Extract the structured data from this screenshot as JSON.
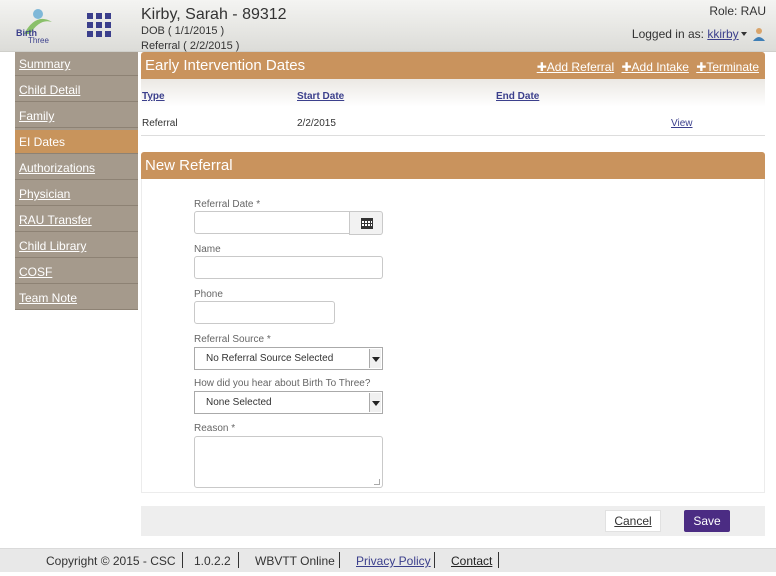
{
  "header": {
    "logo_text": "Birth to Three",
    "child_name": "Kirby, Sarah - 89312",
    "dob": "DOB ( 1/1/2015 )",
    "referral": "Referral ( 2/2/2015 )",
    "role": "Role: RAU",
    "logged_in_label": "Logged in as:",
    "username": "kkirby"
  },
  "sidebar": {
    "items": [
      {
        "label": "Summary"
      },
      {
        "label": "Child Detail"
      },
      {
        "label": "Family"
      },
      {
        "label": "EI Dates"
      },
      {
        "label": "Authorizations"
      },
      {
        "label": "Physician"
      },
      {
        "label": "RAU Transfer"
      },
      {
        "label": "Child Library"
      },
      {
        "label": "COSF"
      },
      {
        "label": "Team Note"
      }
    ],
    "active_index": 3
  },
  "ei_dates": {
    "title": "Early Intervention Dates",
    "actions": [
      "Add Referral",
      "Add Intake",
      "Terminate"
    ],
    "columns": [
      "Type",
      "Start Date",
      "End Date"
    ],
    "rows": [
      {
        "type": "Referral",
        "start": "2/2/2015",
        "end": "",
        "action": "View"
      }
    ]
  },
  "new_referral": {
    "title": "New Referral",
    "fields": {
      "referral_date": {
        "label": "Referral Date",
        "value": ""
      },
      "name": {
        "label": "Name",
        "value": ""
      },
      "phone": {
        "label": "Phone",
        "value": ""
      },
      "referral_source": {
        "label": "Referral Source",
        "value": "No Referral Source Selected"
      },
      "heard_about": {
        "label": "How did you hear about Birth To Three?",
        "value": "None Selected"
      },
      "reason": {
        "label": "Reason",
        "value": ""
      }
    },
    "required_marker": "*",
    "cancel_label": "Cancel",
    "save_label": "Save"
  },
  "footer": {
    "copyright": "Copyright © 2015 - CSC",
    "version": "1.0.2.2",
    "app_name": "WBVTT Online",
    "privacy": "Privacy Policy",
    "contact": "Contact"
  },
  "colors": {
    "accent": "#c9935d",
    "sidebar": "#a59a8c",
    "primary_button": "#4b2c83",
    "link": "#3b3f8c"
  }
}
